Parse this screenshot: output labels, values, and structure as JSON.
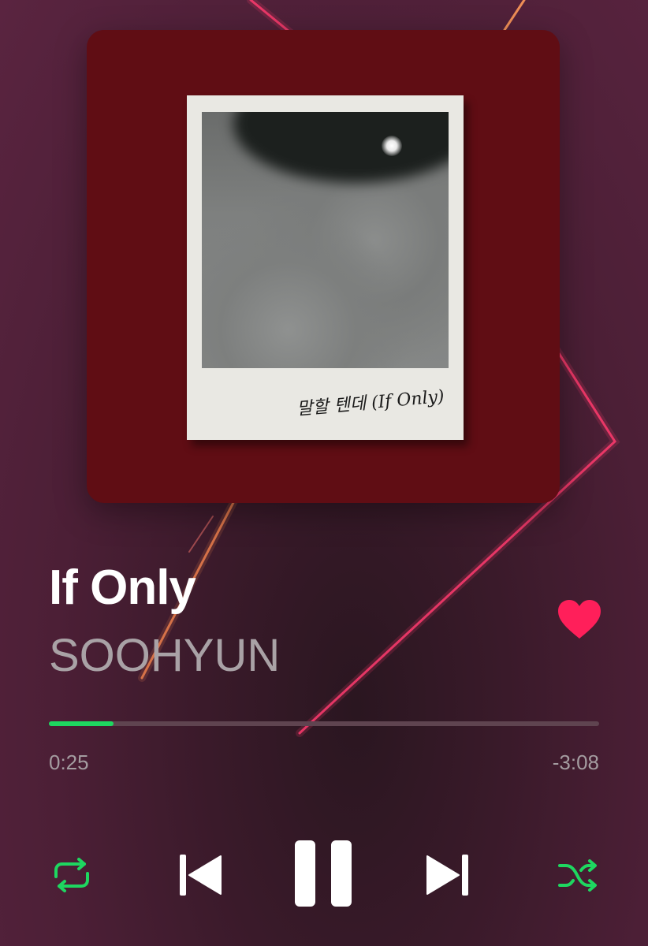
{
  "album_art": {
    "caption": "말할 텐데 (If Only)"
  },
  "track": {
    "title": "If Only",
    "artist": "SOOHYUN",
    "liked": true
  },
  "progress": {
    "elapsed": "0:25",
    "remaining": "-3:08",
    "fraction": 0.117
  },
  "controls": {
    "repeat_icon": "repeat-icon",
    "previous_icon": "skip-previous-icon",
    "pause_icon": "pause-icon",
    "next_icon": "skip-next-icon",
    "shuffle_icon": "shuffle-icon"
  },
  "colors": {
    "accent": "#1ed760",
    "like": "#ff1f5a",
    "art_background": "#600d14"
  }
}
